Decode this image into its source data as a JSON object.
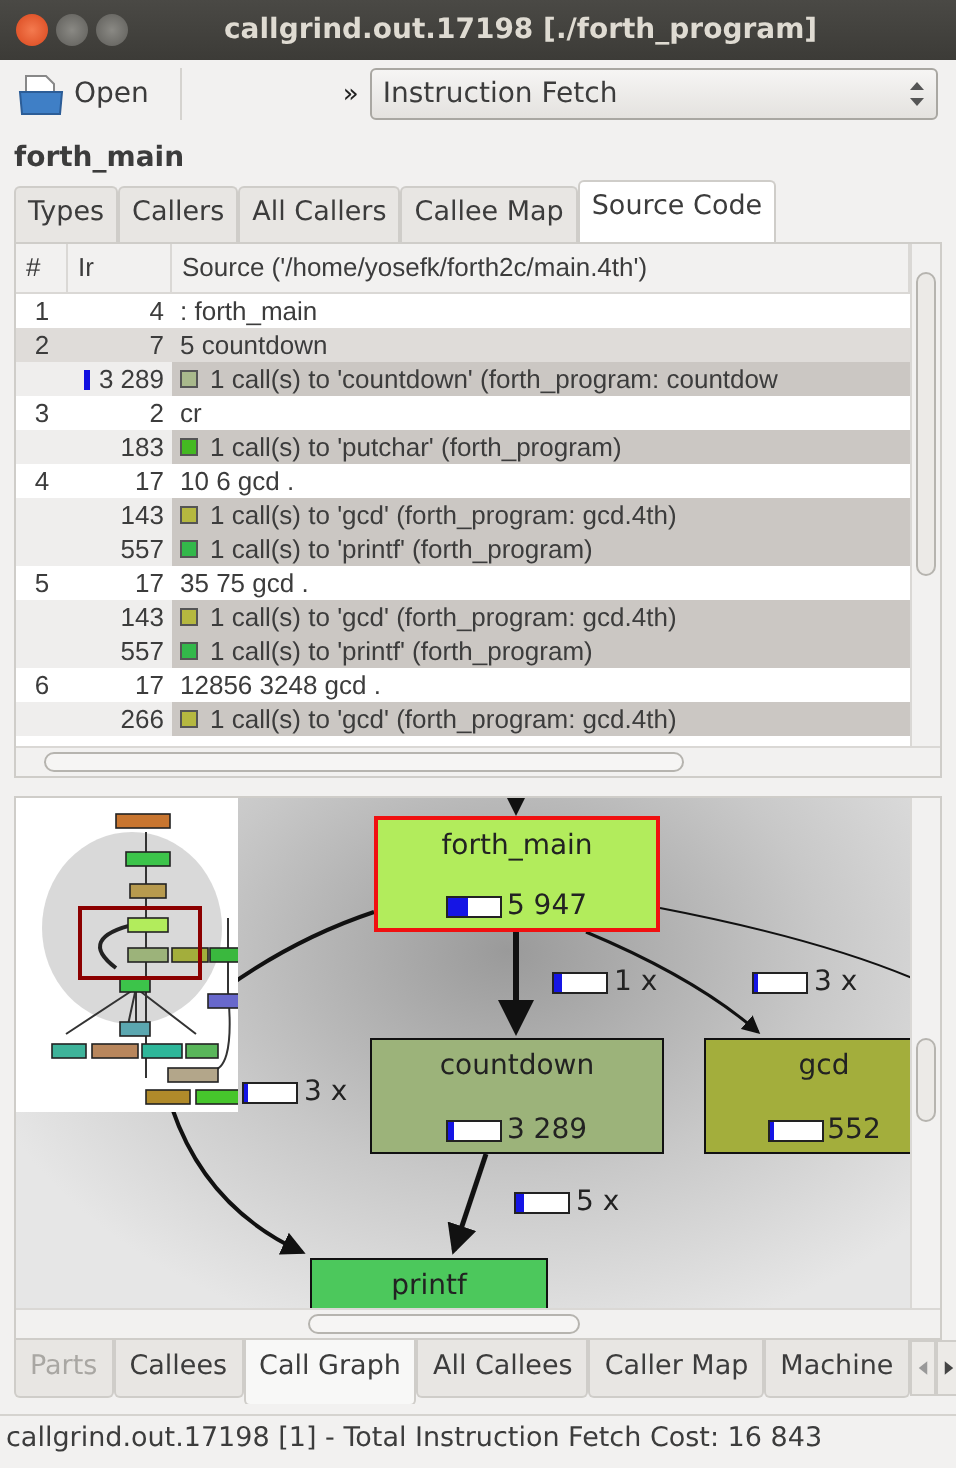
{
  "window": {
    "title": "callgrind.out.17198 [./forth_program]"
  },
  "toolbar": {
    "open_label": "Open",
    "more": "»",
    "event_type": "Instruction Fetch"
  },
  "function_name": "forth_main",
  "top_tabs": [
    {
      "label": "Types",
      "selected": false
    },
    {
      "label": "Callers",
      "selected": false
    },
    {
      "label": "All Callers",
      "selected": false
    },
    {
      "label": "Callee Map",
      "selected": false
    },
    {
      "label": "Source Code",
      "selected": true
    }
  ],
  "source_table": {
    "columns": [
      "#",
      "Ir",
      "Source ('/home/yosefk/forth2c/main.4th')"
    ],
    "rows": [
      {
        "kind": "source",
        "line": "1",
        "ir": "4",
        "text": ": forth_main",
        "selected": false
      },
      {
        "kind": "source",
        "line": "2",
        "ir": "7",
        "text": "5 countdown",
        "selected": true
      },
      {
        "kind": "call",
        "ir": "3 289",
        "text": "1 call(s) to 'countdown' (forth_program: countdow",
        "color": "#a9b98c",
        "cost_bar": true,
        "selected": false
      },
      {
        "kind": "source",
        "line": "3",
        "ir": "2",
        "text": "cr",
        "selected": false
      },
      {
        "kind": "call",
        "ir": "183",
        "text": "1 call(s) to 'putchar' (forth_program)",
        "color": "#44b922",
        "selected": false
      },
      {
        "kind": "source",
        "line": "4",
        "ir": "17",
        "text": "10 6 gcd .",
        "selected": false
      },
      {
        "kind": "call",
        "ir": "143",
        "text": "1 call(s) to 'gcd' (forth_program: gcd.4th)",
        "color": "#b5b840",
        "selected": false
      },
      {
        "kind": "call",
        "ir": "557",
        "text": "1 call(s) to 'printf' (forth_program)",
        "color": "#33b84a",
        "selected": false
      },
      {
        "kind": "source",
        "line": "5",
        "ir": "17",
        "text": "35 75 gcd .",
        "selected": false
      },
      {
        "kind": "call",
        "ir": "143",
        "text": "1 call(s) to 'gcd' (forth_program: gcd.4th)",
        "color": "#b5b840",
        "selected": false
      },
      {
        "kind": "call",
        "ir": "557",
        "text": "1 call(s) to 'printf' (forth_program)",
        "color": "#33b84a",
        "selected": false
      },
      {
        "kind": "source",
        "line": "6",
        "ir": "17",
        "text": "12856 3248 gcd .",
        "selected": false
      },
      {
        "kind": "call",
        "ir": "266",
        "text": "1 call(s) to 'gcd' (forth_program: gcd.4th)",
        "color": "#b5b840",
        "selected": false
      }
    ]
  },
  "call_graph": {
    "nodes": [
      {
        "name": "forth_main",
        "cost": "5 947",
        "level": 0.35,
        "color": "#b2ec5c",
        "selected": true
      },
      {
        "name": "countdown",
        "cost": "3 289",
        "level": 0.1,
        "color": "#9cb37a",
        "selected": false
      },
      {
        "name": "gcd",
        "cost": "552",
        "level": 0.04,
        "color": "#a3ae3c",
        "selected": false
      },
      {
        "name": "printf",
        "color": "#4cc85c",
        "selected": false
      }
    ],
    "edge_labels": [
      {
        "text": "1 x",
        "level": 0.15
      },
      {
        "text": "3 x",
        "level": 0.04
      },
      {
        "text": "3 x",
        "level": 0.04
      },
      {
        "text": "5 x",
        "level": 0.15
      }
    ]
  },
  "bottom_tabs": [
    {
      "label": "Parts",
      "selected": false,
      "disabled": true
    },
    {
      "label": "Callees",
      "selected": false,
      "disabled": false
    },
    {
      "label": "Call Graph",
      "selected": true,
      "disabled": false
    },
    {
      "label": "All Callees",
      "selected": false,
      "disabled": false
    },
    {
      "label": "Caller Map",
      "selected": false,
      "disabled": false
    },
    {
      "label": "Machine",
      "selected": false,
      "disabled": false
    }
  ],
  "status_bar": "callgrind.out.17198 [1] - Total Instruction Fetch Cost: 16 843"
}
